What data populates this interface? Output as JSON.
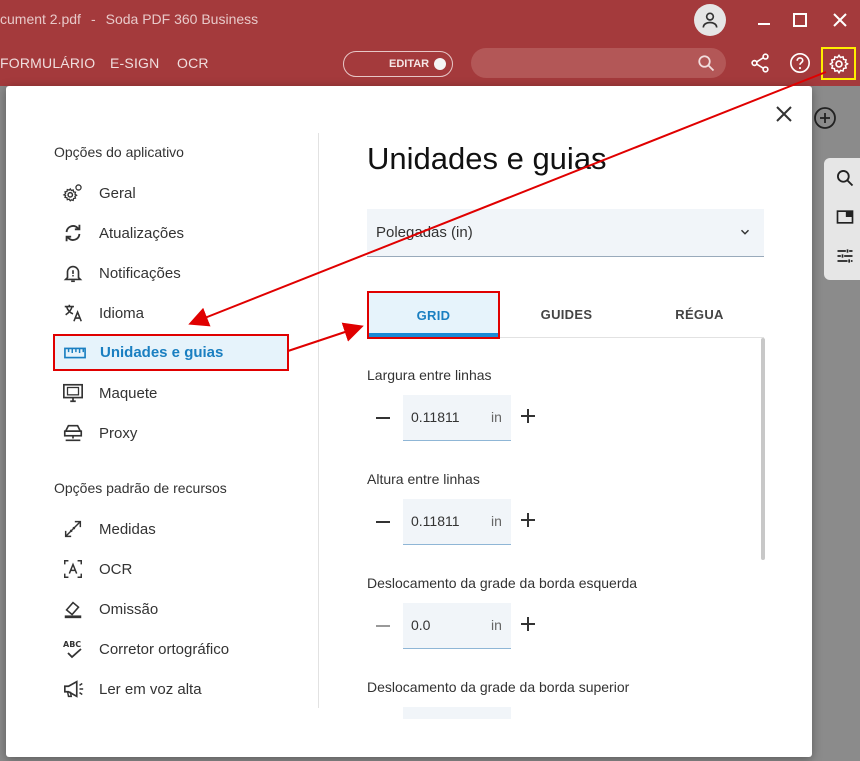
{
  "window": {
    "doc_title": "cument 2.pdf",
    "separator": "-",
    "app_title": "Soda PDF 360 Business"
  },
  "menubar": {
    "items": [
      "FORMULÁRIO",
      "E-SIGN",
      "OCR"
    ],
    "edit_label": "EDITAR"
  },
  "settings": {
    "nav": {
      "app_section_title": "Opções do aplicativo",
      "app_items": [
        {
          "label": "Geral",
          "icon": "gear-icon"
        },
        {
          "label": "Atualizações",
          "icon": "sync-icon"
        },
        {
          "label": "Notificações",
          "icon": "bell-icon"
        },
        {
          "label": "Idioma",
          "icon": "translate-icon"
        },
        {
          "label": "Unidades e guias",
          "icon": "ruler-icon"
        },
        {
          "label": "Maquete",
          "icon": "monitor-icon"
        },
        {
          "label": "Proxy",
          "icon": "proxy-icon"
        }
      ],
      "resource_section_title": "Opções padrão de recursos",
      "resource_items": [
        {
          "label": "Medidas",
          "icon": "measure-icon"
        },
        {
          "label": "OCR",
          "icon": "ocr-icon"
        },
        {
          "label": "Omissão",
          "icon": "eraser-icon"
        },
        {
          "label": "Corretor ortográfico",
          "icon": "spellcheck-icon"
        },
        {
          "label": "Ler em voz alta",
          "icon": "megaphone-icon"
        }
      ],
      "active_item": "Unidades e guias"
    },
    "content": {
      "title": "Unidades e guias",
      "unit_select": "Polegadas (in)",
      "tabs": [
        "GRID",
        "GUIDES",
        "RÉGUA"
      ],
      "active_tab": "GRID",
      "fields": [
        {
          "label": "Largura entre linhas",
          "value": "0.11811",
          "unit": "in"
        },
        {
          "label": "Altura entre linhas",
          "value": "0.11811",
          "unit": "in"
        },
        {
          "label": "Deslocamento da grade da borda esquerda",
          "value": "0.0",
          "unit": "in"
        },
        {
          "label": "Deslocamento da grade da borda superior",
          "value": "",
          "unit": ""
        }
      ]
    }
  },
  "colors": {
    "app_red": "#a43a3c",
    "accent_blue": "#1a7fc1",
    "highlight_red": "#e00000",
    "highlight_yellow": "#ffee00"
  }
}
